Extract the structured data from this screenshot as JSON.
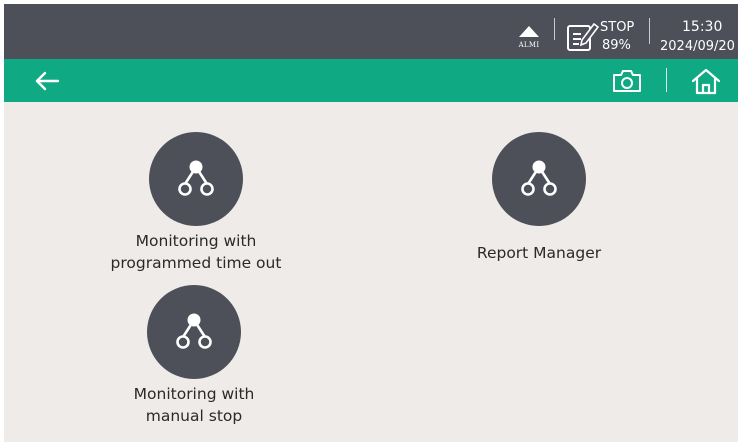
{
  "status_bar": {
    "alarm_label": "ALMI",
    "device_state": "STOP",
    "battery": "89%",
    "time": "15:30",
    "date": "2024/09/20"
  },
  "toolbar": {
    "back_icon": "arrow-left-icon",
    "camera_icon": "camera-icon",
    "home_icon": "home-icon"
  },
  "apps": [
    {
      "label": "Monitoring with\nprogrammed time out",
      "icon": "workflow-icon"
    },
    {
      "label": "Report Manager",
      "icon": "workflow-icon"
    },
    {
      "label": "Monitoring with\nmanual stop",
      "icon": "workflow-icon"
    }
  ],
  "colors": {
    "status_bar_bg": "#4d4f59",
    "toolbar_bg": "#0faa84",
    "content_bg": "#eeebe8",
    "icon_circle": "#4d4f59"
  }
}
